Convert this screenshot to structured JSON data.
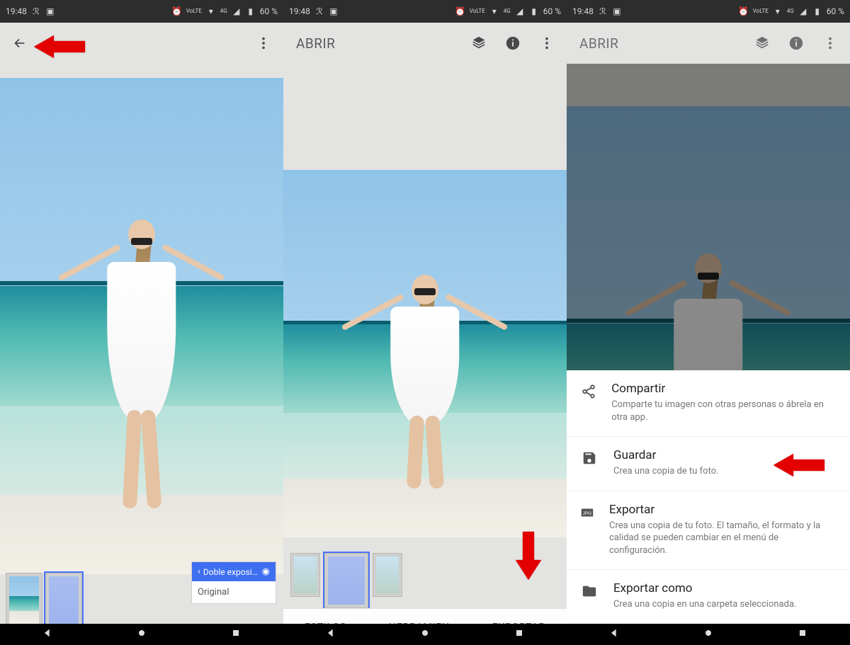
{
  "status": {
    "time": "19:48",
    "lte": "VoLTE",
    "net": "4G",
    "battery": "60 %"
  },
  "screen1": {
    "tooltip_title": "Doble exposici…",
    "tooltip_sub": "Original"
  },
  "screen2": {
    "title": "ABRIR",
    "tabs": {
      "styles": "ESTILOS",
      "tools": "HERRAMIEN",
      "export": "EXPORTAR"
    }
  },
  "screen3": {
    "title": "ABRIR",
    "sheet": {
      "share": {
        "t": "Compartir",
        "d": "Comparte tu imagen con otras personas o ábrela en otra app."
      },
      "save": {
        "t": "Guardar",
        "d": "Crea una copia de tu foto."
      },
      "export": {
        "t": "Exportar",
        "d": "Crea una copia de tu foto. El tamaño, el formato y la calidad se pueden cambiar en el menú de configuración."
      },
      "exportas": {
        "t": "Exportar como",
        "d": "Crea una copia en una carpeta seleccionada."
      }
    }
  }
}
